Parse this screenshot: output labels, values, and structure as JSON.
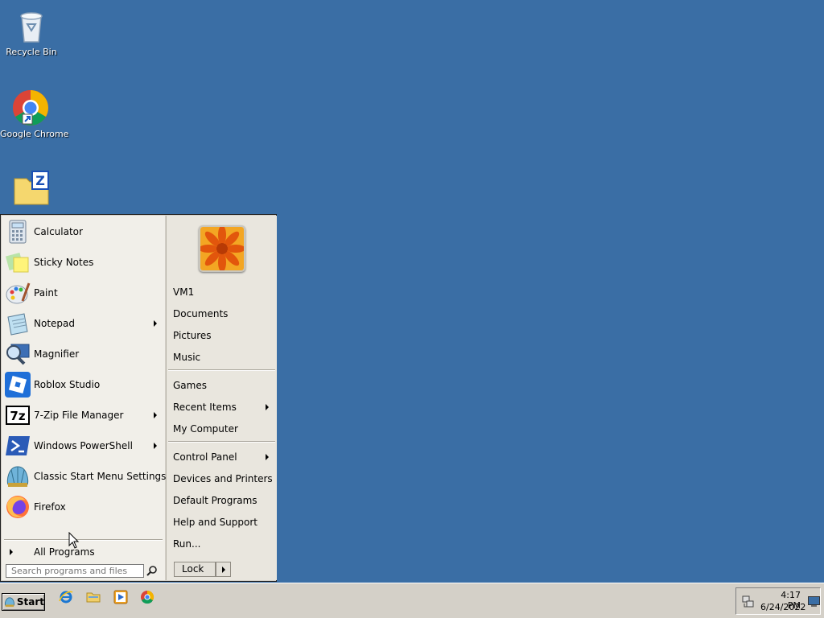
{
  "desktop": {
    "icons": [
      {
        "label": "Recycle Bin",
        "icon": "recycle-bin-icon"
      },
      {
        "label": "Google Chrome",
        "icon": "chrome-icon"
      },
      {
        "label": "",
        "icon": "7zip-folder-icon"
      }
    ]
  },
  "start_menu": {
    "programs": [
      {
        "label": "Calculator",
        "icon": "calculator-icon",
        "submenu": false
      },
      {
        "label": "Sticky Notes",
        "icon": "sticky-notes-icon",
        "submenu": false
      },
      {
        "label": "Paint",
        "icon": "paint-icon",
        "submenu": false
      },
      {
        "label": "Notepad",
        "icon": "notepad-icon",
        "submenu": true
      },
      {
        "label": "Magnifier",
        "icon": "magnifier-icon",
        "submenu": false
      },
      {
        "label": "Roblox Studio",
        "icon": "roblox-studio-icon",
        "submenu": false
      },
      {
        "label": "7-Zip File Manager",
        "icon": "7zip-icon",
        "submenu": true
      },
      {
        "label": "Windows PowerShell",
        "icon": "powershell-icon",
        "submenu": true
      },
      {
        "label": "Classic Start Menu Settings",
        "icon": "classic-shell-icon",
        "submenu": false
      },
      {
        "label": "Firefox",
        "icon": "firefox-icon",
        "submenu": false
      }
    ],
    "all_programs": "All Programs",
    "search_placeholder": "Search programs and files",
    "right_groups": [
      [
        "VM1",
        "Documents",
        "Pictures",
        "Music"
      ],
      [
        "Games",
        "Recent Items",
        "My Computer"
      ],
      [
        "Control Panel",
        "Devices and Printers",
        "Default Programs",
        "Help and Support",
        "Run..."
      ]
    ],
    "right_submenu": [
      "Recent Items",
      "Control Panel"
    ],
    "lock_label": "Lock"
  },
  "taskbar": {
    "start_label": "Start",
    "quicklaunch": [
      "internet-explorer-icon",
      "explorer-folder-icon",
      "media-player-icon",
      "chrome-icon"
    ],
    "clock_time": "4:17 PM",
    "clock_date": "6/24/2022"
  }
}
